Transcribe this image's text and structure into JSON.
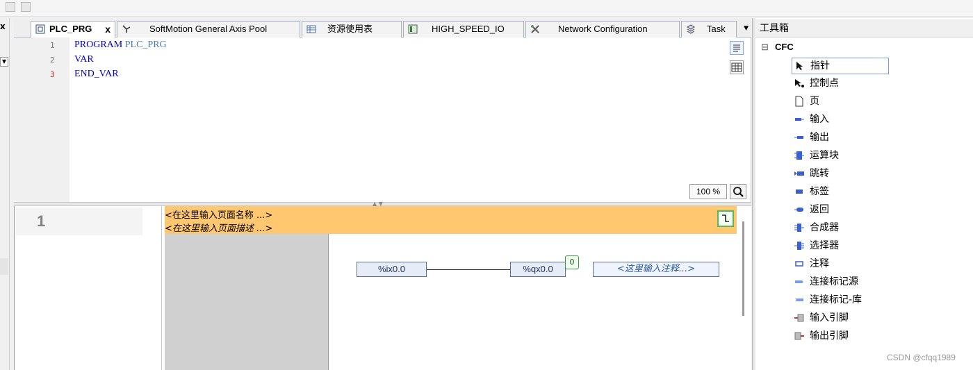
{
  "tabs": [
    {
      "label": "PLC_PRG",
      "active": true,
      "close": "x"
    },
    {
      "label": "SoftMotion General Axis Pool"
    },
    {
      "label": "资源使用表"
    },
    {
      "label": "HIGH_SPEED_IO"
    },
    {
      "label": "Network Configuration"
    },
    {
      "label": "Task"
    }
  ],
  "declaration": {
    "lines": [
      {
        "no": "1",
        "keyword": "PROGRAM",
        "name": "PLC_PRG"
      },
      {
        "no": "2",
        "keyword": "VAR",
        "name": ""
      },
      {
        "no": "3",
        "keyword": "END_VAR",
        "name": ""
      }
    ],
    "zoom": "100 %"
  },
  "cfc": {
    "page_number": "1",
    "page_name_placeholder": "<在这里输入页面名称 ...>",
    "page_desc_placeholder": "<在这里输入页面描述 ...>",
    "input_block": "%ix0.0",
    "output_block": "%qx0.0",
    "exec_order": "0",
    "comment_placeholder": "<这里输入注释...>"
  },
  "toolbox": {
    "title": "工具箱",
    "group": "CFC",
    "items": [
      "指针",
      "控制点",
      "页",
      "输入",
      "输出",
      "运算块",
      "跳转",
      "标签",
      "返回",
      "合成器",
      "选择器",
      "注释",
      "连接标记源",
      "连接标记-库",
      "输入引脚",
      "输出引脚"
    ]
  },
  "watermark": "CSDN @cfqq1989",
  "colors": {
    "header": "#ffc870",
    "keyword": "#0000cc",
    "identifier": "#4a7ab8",
    "block_border": "#5b6d93"
  }
}
